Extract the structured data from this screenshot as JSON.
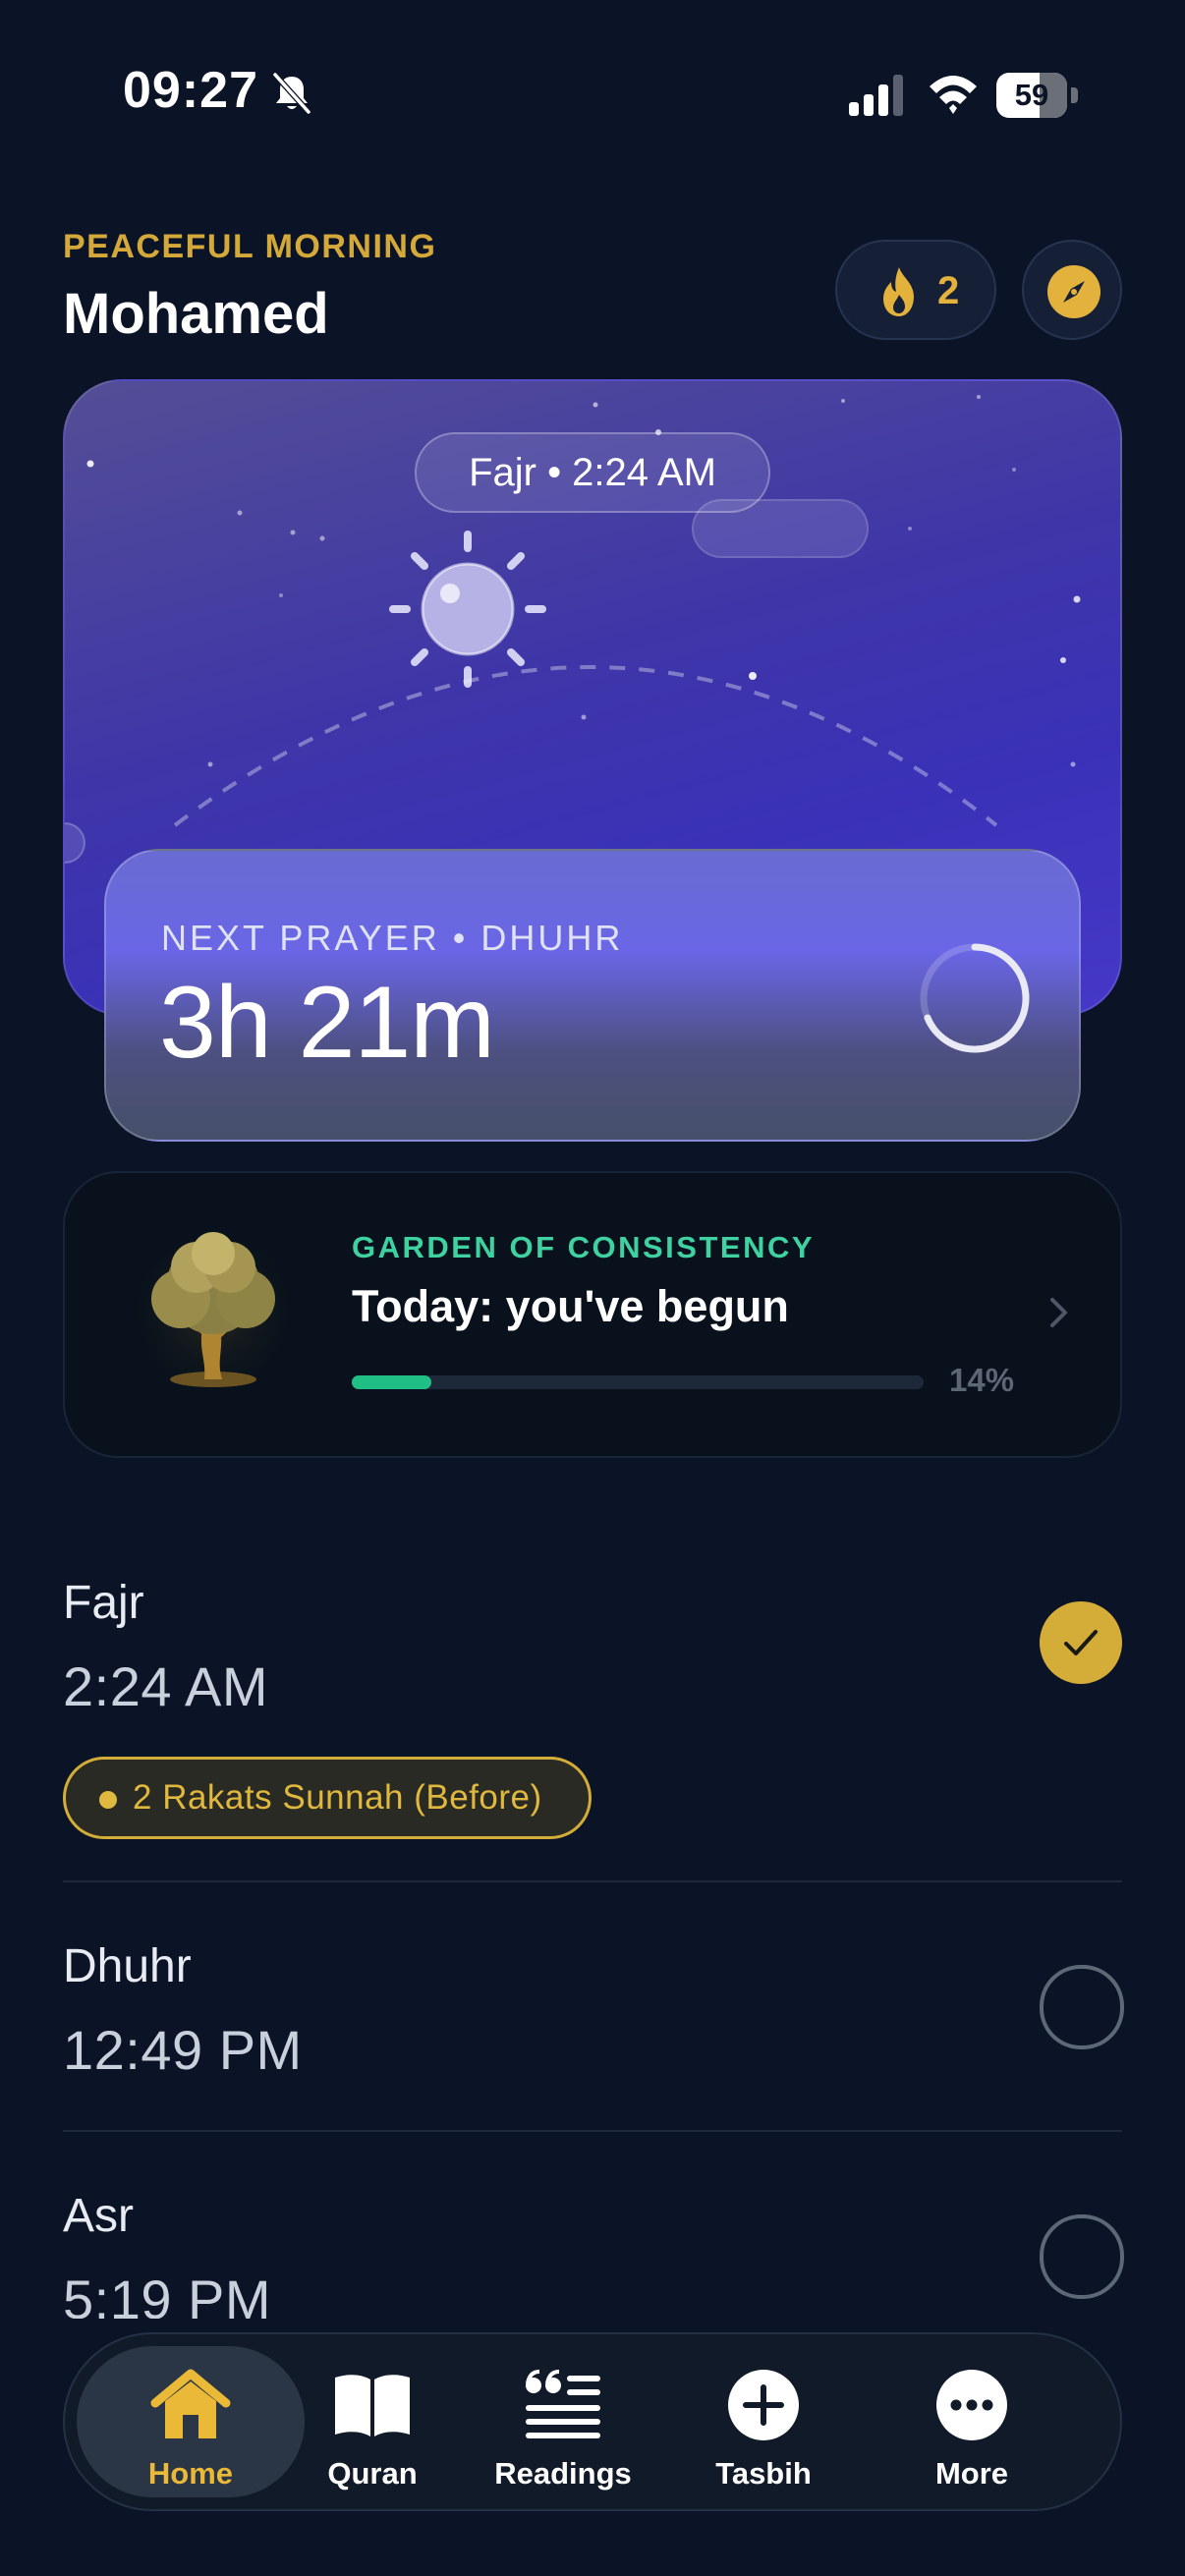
{
  "status_bar": {
    "time": "09:27",
    "battery": "59"
  },
  "header": {
    "greeting": "PEACEFUL MORNING",
    "name": "Mohamed",
    "streak": "2"
  },
  "hero": {
    "current_chip": "Fajr • 2:24 AM"
  },
  "next_prayer": {
    "label": "NEXT PRAYER • DHUHR",
    "countdown": "3h 21m"
  },
  "garden": {
    "kicker": "GARDEN OF CONSISTENCY",
    "title": "Today: you've begun",
    "progress": 0.14,
    "percent_label": "14%"
  },
  "prayers": [
    {
      "name": "Fajr",
      "time": "2:24 AM",
      "done": true,
      "sunnah": "2 Rakats Sunnah (Before)"
    },
    {
      "name": "Dhuhr",
      "time": "12:49 PM",
      "done": false
    },
    {
      "name": "Asr",
      "time": "5:19 PM",
      "done": false
    }
  ],
  "tabs": [
    {
      "label": "Home",
      "icon": "home-icon",
      "active": true
    },
    {
      "label": "Quran",
      "icon": "book-icon",
      "active": false
    },
    {
      "label": "Readings",
      "icon": "quote-lines-icon",
      "active": false
    },
    {
      "label": "Tasbih",
      "icon": "plus-circle-icon",
      "active": false
    },
    {
      "label": "More",
      "icon": "ellipsis-circle-icon",
      "active": false
    }
  ],
  "colors": {
    "background": "#0b1426",
    "gold": "#d4ac38",
    "emerald": "#1fbf86"
  }
}
